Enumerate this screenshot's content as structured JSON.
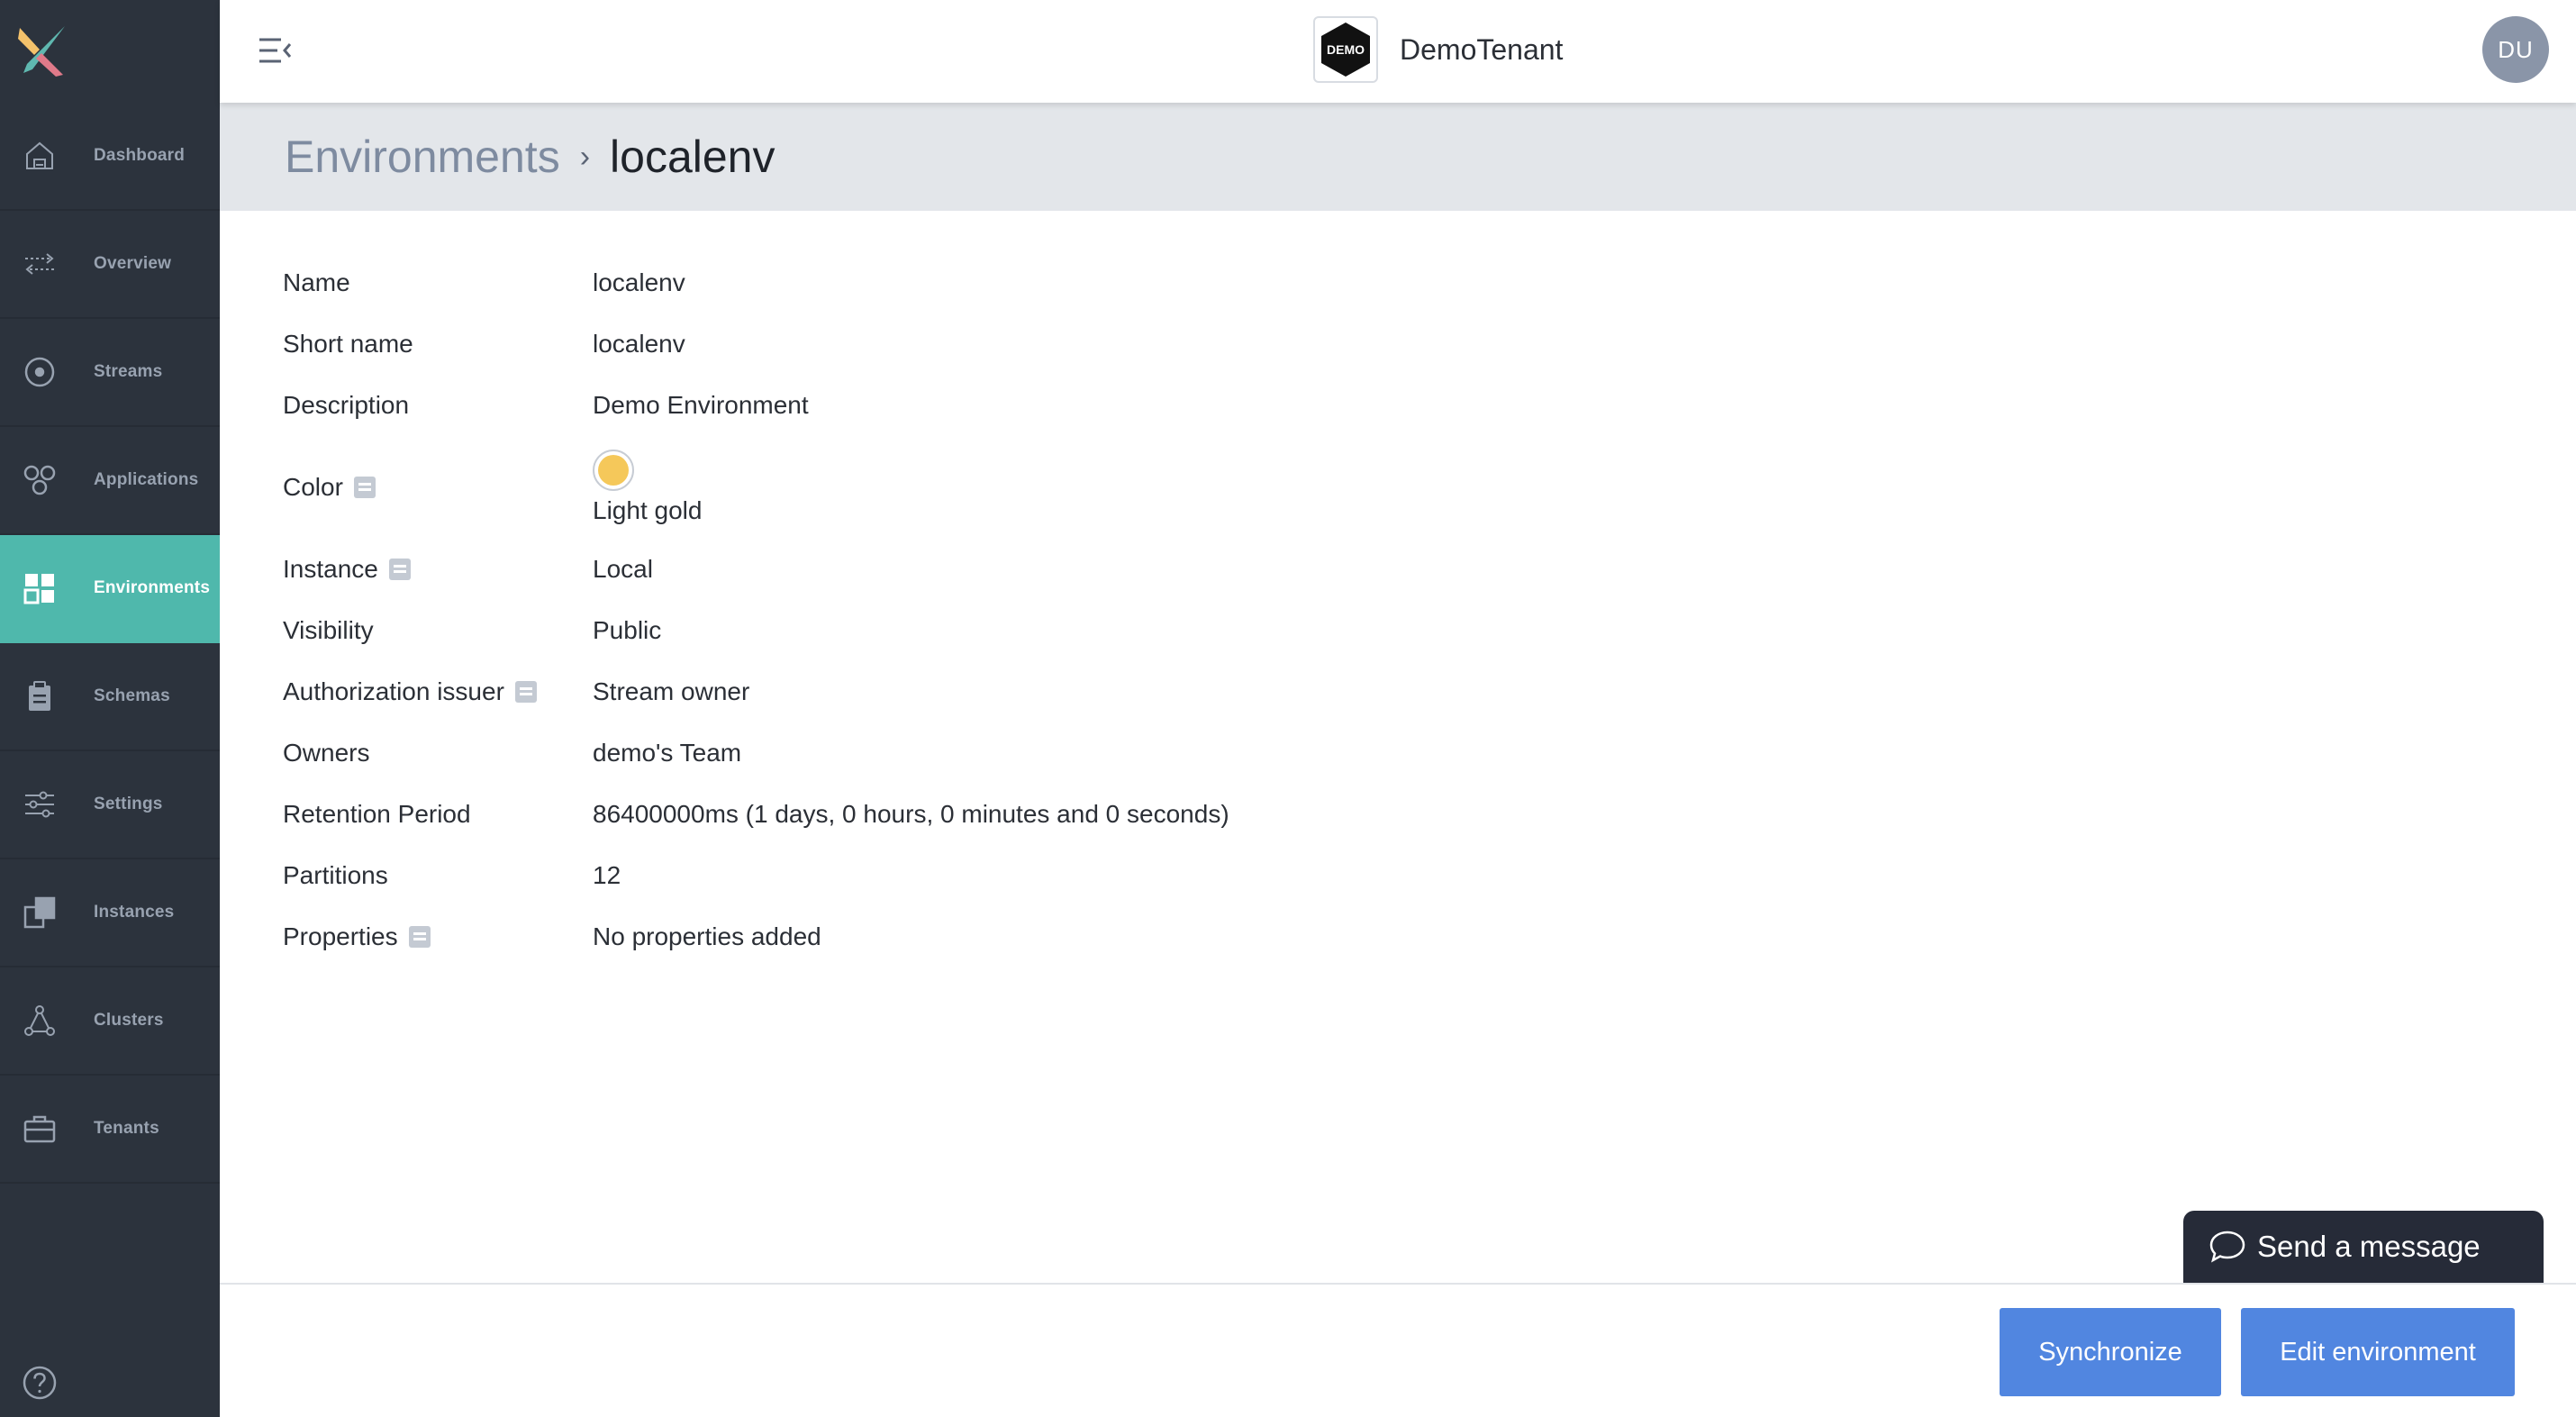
{
  "sidebar": {
    "items": [
      {
        "label": "Dashboard",
        "icon": "home-icon"
      },
      {
        "label": "Overview",
        "icon": "arrows-icon"
      },
      {
        "label": "Streams",
        "icon": "stream-icon"
      },
      {
        "label": "Applications",
        "icon": "applications-icon"
      },
      {
        "label": "Environments",
        "icon": "grid-icon",
        "active": true
      },
      {
        "label": "Schemas",
        "icon": "clipboard-icon"
      },
      {
        "label": "Settings",
        "icon": "sliders-icon"
      },
      {
        "label": "Instances",
        "icon": "instances-icon"
      },
      {
        "label": "Clusters",
        "icon": "cluster-icon"
      },
      {
        "label": "Tenants",
        "icon": "briefcase-icon"
      }
    ]
  },
  "header": {
    "tenant_badge": "DEMO",
    "tenant_name": "DemoTenant",
    "avatar_initials": "DU"
  },
  "breadcrumb": {
    "root": "Environments",
    "separator": "›",
    "current": "localenv"
  },
  "details": {
    "name": {
      "label": "Name",
      "value": "localenv"
    },
    "short_name": {
      "label": "Short name",
      "value": "localenv"
    },
    "description": {
      "label": "Description",
      "value": "Demo Environment"
    },
    "color": {
      "label": "Color",
      "value": "Light gold",
      "hex": "#f5c85a"
    },
    "instance": {
      "label": "Instance",
      "value": "Local"
    },
    "visibility": {
      "label": "Visibility",
      "value": "Public"
    },
    "auth_issuer": {
      "label": "Authorization issuer",
      "value": "Stream owner"
    },
    "owners": {
      "label": "Owners",
      "value": "demo's Team"
    },
    "retention": {
      "label": "Retention Period",
      "value": "86400000ms (1 days, 0 hours, 0 minutes and 0 seconds)"
    },
    "partitions": {
      "label": "Partitions",
      "value": "12"
    },
    "properties": {
      "label": "Properties",
      "value": "No properties added"
    }
  },
  "footer": {
    "sync_label": "Synchronize",
    "edit_label": "Edit environment"
  },
  "chat": {
    "label": "Send a message"
  },
  "colors": {
    "sidebar_bg": "#2c333d",
    "active_teal": "#4fb8ac",
    "button_blue": "#5186e0",
    "link_blue": "#4a7fdc"
  }
}
